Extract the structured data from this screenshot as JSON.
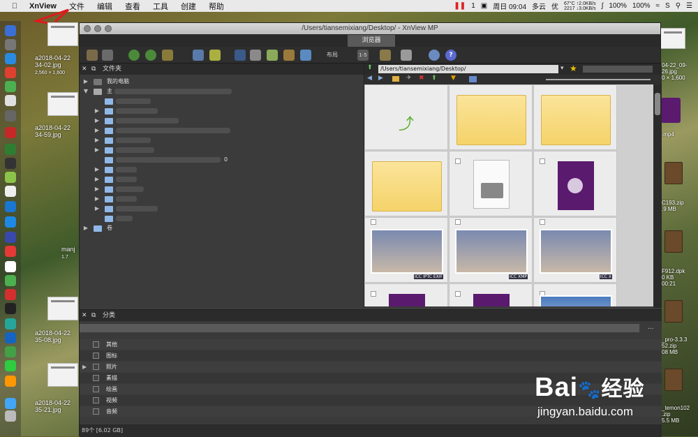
{
  "menubar": {
    "app_name": "XnView",
    "menus": [
      "文件",
      "编辑",
      "查看",
      "工具",
      "创建",
      "帮助"
    ],
    "status_items": {
      "weekday_time": "周日 09:04",
      "weather": "多云",
      "weather_quality": "优",
      "notification_count": "1",
      "cpu_temp": "67°C",
      "cpu_freq": "2217",
      "net_up": "↑2.0KB/s",
      "net_down": "↓3.0KB/s",
      "battery1": "100%",
      "battery2": "100%"
    }
  },
  "desktop": {
    "files": [
      {
        "name": "a2018-04-22",
        "sub": "34-02.jpg",
        "info": "2,560 × 1,600"
      },
      {
        "name": "a2018-04-22",
        "sub": "34-59.jpg"
      },
      {
        "name": "manj",
        "sub": "1.7"
      },
      {
        "name": "a2018-04-22",
        "sub": "35-08.jpg"
      },
      {
        "name": "a2018-04-22",
        "sub": "35-21.jpg"
      }
    ],
    "right_files": [
      {
        "name": "04-22_09-",
        "sub": "26.jpg",
        "info": "0 × 1,600"
      },
      {
        "name": ".mp4"
      },
      {
        "name": "C193.zip",
        "info": ".9 MB"
      },
      {
        "name": "F912.dpk",
        "info": "0 KB"
      },
      {
        "name": "00:21"
      },
      {
        "name": "_pro-3.3.3",
        "sub": "52.zip",
        "info": "08 MB"
      },
      {
        "name": "_temon102",
        "sub": ".zip",
        "info": "5.5 MB"
      }
    ]
  },
  "window": {
    "title": "/Users/tiansemixiang/Desktop/ - XnView MP",
    "tab_label": "浏览器",
    "layout_label": "布局",
    "counter_label": "1-5",
    "folders_panel": {
      "title": "文件夹",
      "root_items": [
        {
          "label": "我的电脑",
          "expanded": false
        },
        {
          "label": "主",
          "expanded": true
        },
        {
          "label": "卷",
          "expanded": false
        }
      ],
      "subfolder_suffix": "0"
    },
    "browser": {
      "path": "/Users/tiansemixiang/Desktop/",
      "screenshot_tags": [
        [
          "ICC",
          "IPTC",
          "EXIF"
        ],
        [
          "ICC",
          "XMP"
        ],
        [
          "ICC",
          "X"
        ]
      ]
    },
    "category_panel": {
      "title": "分类",
      "more": "...",
      "items": [
        "其他",
        "图标",
        "照片",
        "素描",
        "绘画",
        "视频",
        "音频"
      ]
    },
    "status_text": "89个 [6.02 GB]"
  },
  "watermark": {
    "brand": "Bai",
    "brand_cn": "经验",
    "url": "jingyan.baidu.com"
  },
  "colors": {
    "panel": "#3b3b3b",
    "folder_yellow": "#f5d36a",
    "video_purple": "#5a1a6e",
    "accent_arrow": "#e0191e"
  }
}
